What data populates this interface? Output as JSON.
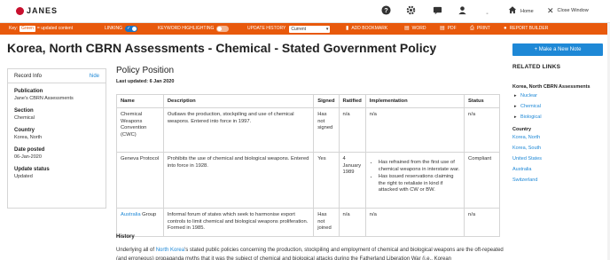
{
  "header": {
    "logo_text": "JANES",
    "home_label": "Home",
    "close_label": "Close Window"
  },
  "toolbar": {
    "key_label": "Key:",
    "key_chip": "Green",
    "key_rest": "= updated content",
    "linking_label": "LINKING",
    "keyword_label": "KEYWORD HIGHLIGHTING",
    "history_label": "UPDATE HISTORY",
    "history_value": "Current",
    "add_bookmark": "ADD BOOKMARK",
    "word": "WORD",
    "pdf": "PDF",
    "print": "PRINT",
    "report_builder": "REPORT BUILDER"
  },
  "page": {
    "title": "Korea, North CBRN Assessments - Chemical - Stated Government Policy",
    "note_button": "Make a New Note"
  },
  "record_info": {
    "title": "Record Info",
    "hide": "hide",
    "fields": [
      {
        "label": "Publication",
        "value": "Jane's CBRN Assessments"
      },
      {
        "label": "Section",
        "value": "Chemical"
      },
      {
        "label": "Country",
        "value": "Korea, North"
      },
      {
        "label": "Date posted",
        "value": "06-Jan-2020"
      },
      {
        "label": "Update status",
        "value": "Updated"
      }
    ]
  },
  "main": {
    "heading": "Policy Position",
    "last_updated": "Last updated: 6 Jan 2020",
    "columns": [
      "Name",
      "Description",
      "Signed",
      "Ratified",
      "Implementation",
      "Status"
    ],
    "rows": [
      {
        "name": "Chemical Weapons Convention (CWC)",
        "description": "Outlaws the production, stockpiling and use of chemical weapons. Entered into force in 1997.",
        "signed": "Has not signed",
        "ratified": "n/a",
        "implementation": "n/a",
        "status": "n/a"
      },
      {
        "name": "Geneva Protocol",
        "description": "Prohibits the use of chemical and biological weapons. Entered into force in 1928.",
        "signed": "Yes",
        "ratified": "4 January 1989",
        "impl_1": "Has refrained from the first use of chemical weapons in interstate war.",
        "impl_2": "Has issued reservations claiming the right to retaliate in kind if attacked with CW or BW.",
        "status": "Compliant"
      },
      {
        "name_link": "Australia",
        "name_rest": " Group",
        "description": "Informal forum of states which seek to harmonise export controls to limit chemical and biological weapons proliferation. Formed in 1985.",
        "signed": "Has not joined",
        "ratified": "n/a",
        "implementation": "n/a",
        "status": "n/a"
      }
    ],
    "history_heading": "History",
    "history_pre": "Underlying all of ",
    "history_link": "North Korea",
    "history_post": "'s stated public policies concerning the production, stockpiling and employment of chemical and biological weapons are the oft-repeated (and erroneous) propaganda myths that it was the subject of chemical and biological attacks during the Fatherland Liberation War (i.e., Korean"
  },
  "related": {
    "title": "RELATED LINKS",
    "group": "Korea, North CBRN Assessments",
    "sub_links": [
      "Nuclear",
      "Chemical",
      "Biological"
    ],
    "country_label": "Country",
    "countries": [
      "Korea, North",
      "Korea, South",
      "United States",
      "Australia",
      "Switzerland"
    ]
  },
  "colors": {
    "toolbar": "#e8590c",
    "accent": "#1e88d6",
    "logo": "#c8102e"
  }
}
